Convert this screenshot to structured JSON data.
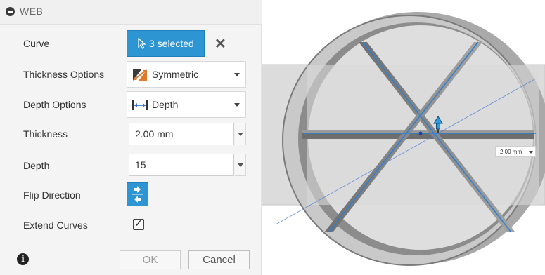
{
  "dialog": {
    "title": "WEB",
    "rows": {
      "curve": {
        "label": "Curve",
        "button_label": "3 selected"
      },
      "thickness_options": {
        "label": "Thickness Options",
        "value": "Symmetric"
      },
      "depth_options": {
        "label": "Depth Options",
        "value": "Depth"
      },
      "thickness": {
        "label": "Thickness",
        "value": "2.00 mm"
      },
      "depth": {
        "label": "Depth",
        "value": "15"
      },
      "flip_direction": {
        "label": "Flip Direction"
      },
      "extend_curves": {
        "label": "Extend Curves",
        "checked": true
      }
    },
    "footer": {
      "ok_label": "OK",
      "cancel_label": "Cancel"
    }
  },
  "viewport": {
    "dimension_callout": "2.00 mm"
  },
  "colors": {
    "accent": "#2e95d3",
    "panel_bg": "#f4f4f4",
    "model_gray": "#8c8c8c",
    "sketch_line": "#2f7fd1"
  }
}
